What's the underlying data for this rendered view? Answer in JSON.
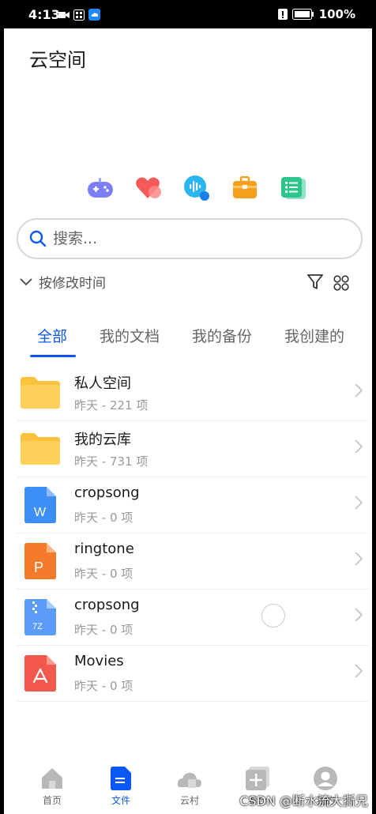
{
  "status_bar": {
    "time": "4:13",
    "battery": "100%"
  },
  "page_title": "云空间",
  "quick_icons": [
    {
      "name": "game-icon",
      "color": "#7b7ff5"
    },
    {
      "name": "heart-icon",
      "color": "#f55a5a"
    },
    {
      "name": "voice-icon",
      "color": "#2bb6f0"
    },
    {
      "name": "briefcase-icon",
      "color": "#f5a01c"
    },
    {
      "name": "notes-icon",
      "color": "#2ec58d"
    }
  ],
  "search": {
    "placeholder": "搜索..."
  },
  "sort": {
    "label": "按修改时间"
  },
  "tabs": [
    {
      "label": "全部",
      "active": true
    },
    {
      "label": "我的文档"
    },
    {
      "label": "我的备份"
    },
    {
      "label": "我创建的"
    }
  ],
  "files": [
    {
      "name": "私人空间",
      "meta": "昨天 - 221 项",
      "type": "folder"
    },
    {
      "name": "我的云库",
      "meta": "昨天 - 731 项",
      "type": "folder"
    },
    {
      "name": "cropsong",
      "meta": "昨天 - 0 项",
      "type": "word",
      "badge": "W"
    },
    {
      "name": "ringtone",
      "meta": "昨天 - 0 项",
      "type": "ppt",
      "badge": "P"
    },
    {
      "name": "cropsong",
      "meta": "昨天 - 0 项",
      "type": "zip",
      "badge": "7Z"
    },
    {
      "name": "Movies",
      "meta": "昨天 - 0 项",
      "type": "pdf"
    }
  ],
  "bottom_nav": [
    {
      "label": "首页"
    },
    {
      "label": "文件",
      "active": true
    },
    {
      "label": "云村"
    },
    {
      "label": "看合"
    },
    {
      "label": "我的"
    }
  ],
  "watermark": "CSDN @断水流大撕兄",
  "colors": {
    "accent": "#0a59f7",
    "folder": "#ffc23d"
  }
}
